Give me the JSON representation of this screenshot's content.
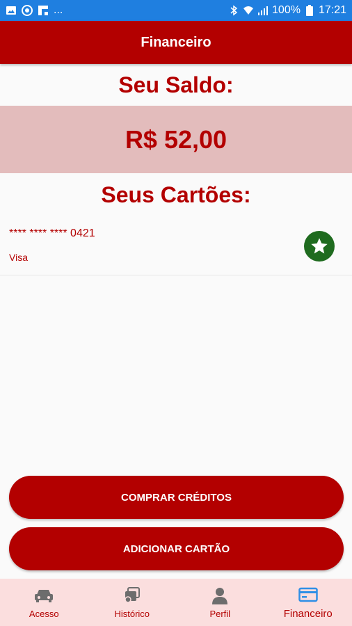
{
  "status_bar": {
    "icons_left": [
      "image-icon",
      "target-icon",
      "flipboard-icon"
    ],
    "overflow": "...",
    "battery": "100%",
    "time": "17:21"
  },
  "app_bar": {
    "title": "Financeiro"
  },
  "balance": {
    "title": "Seu Saldo:",
    "value": "R$ 52,00"
  },
  "cards": {
    "title": "Seus Cartões:",
    "items": [
      {
        "number": "**** **** **** 0421",
        "brand": "Visa",
        "favorite_icon": "star-icon"
      }
    ]
  },
  "buttons": {
    "buy_credits": "COMPRAR CRÉDITOS",
    "add_card": "ADICIONAR CARTÃO"
  },
  "bottom_nav": {
    "items": [
      {
        "label": "Acesso",
        "icon": "car-icon"
      },
      {
        "label": "Histórico",
        "icon": "history-icon"
      },
      {
        "label": "Perfil",
        "icon": "person-icon"
      },
      {
        "label": "Financeiro",
        "icon": "card-icon",
        "active": true
      }
    ]
  },
  "colors": {
    "primary": "#b30000",
    "balance_bg": "#e3bcbc",
    "nav_bg": "#fbdede",
    "nav_icon_inactive": "#6d6d6d",
    "nav_icon_active": "#2f8fe6",
    "favorite": "#1f6b1f",
    "status_bar": "#1f7fe0"
  }
}
